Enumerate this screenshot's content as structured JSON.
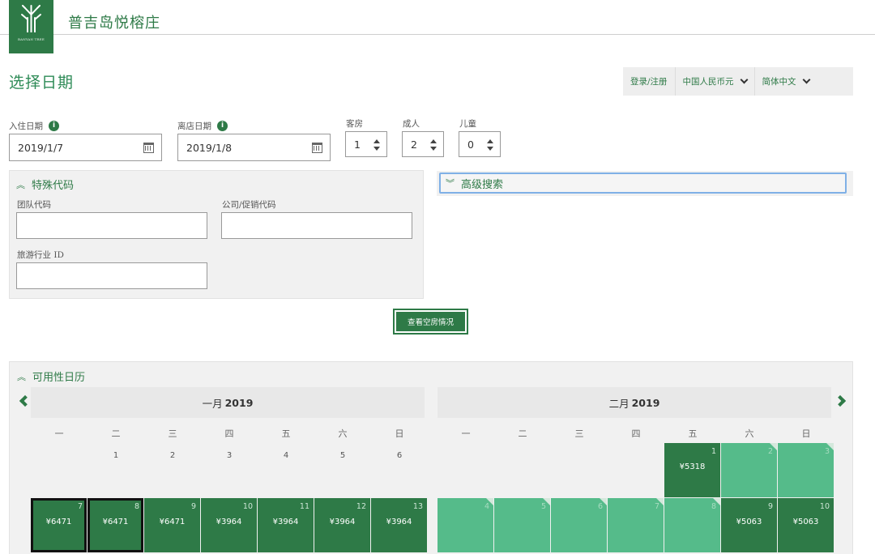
{
  "header": {
    "logo_text": "BANYAN TREE",
    "hotel_name": "普吉岛悦榕庄"
  },
  "page_title": "选择日期",
  "top_controls": {
    "login": "登录/注册",
    "currency": "中国人民币元",
    "language": "简体中文"
  },
  "search": {
    "checkin_label": "入住日期",
    "checkin_value": "2019/1/7",
    "checkout_label": "离店日期",
    "checkout_value": "2019/1/8",
    "rooms_label": "客房",
    "rooms_value": "1",
    "adults_label": "成人",
    "adults_value": "2",
    "children_label": "儿童",
    "children_value": "0"
  },
  "special_codes": {
    "title": "特殊代码",
    "group_label": "团队代码",
    "group_value": "",
    "corp_label": "公司/促销代码",
    "corp_value": "",
    "travel_label": "旅游行业 ID",
    "travel_value": ""
  },
  "advanced_search": {
    "title": "高级搜索"
  },
  "check_button": "查看空房情况",
  "availability": {
    "title": "可用性日历",
    "weekdays": [
      "一",
      "二",
      "三",
      "四",
      "五",
      "六",
      "日"
    ],
    "months": [
      {
        "name": "一月",
        "year": "2019",
        "week1": [
          "",
          "1",
          "2",
          "3",
          "4",
          "5",
          "6"
        ],
        "week2": [
          {
            "day": "7",
            "price": "¥6471",
            "selected": true
          },
          {
            "day": "8",
            "price": "¥6471",
            "selected": true
          },
          {
            "day": "9",
            "price": "¥6471"
          },
          {
            "day": "10",
            "price": "¥3964"
          },
          {
            "day": "11",
            "price": "¥3964"
          },
          {
            "day": "12",
            "price": "¥3964"
          },
          {
            "day": "13",
            "price": "¥3964"
          }
        ]
      },
      {
        "name": "二月",
        "year": "2019",
        "week1": [
          {
            "day": "",
            "price": ""
          },
          {
            "day": "",
            "price": ""
          },
          {
            "day": "",
            "price": ""
          },
          {
            "day": "",
            "price": ""
          },
          {
            "day": "1",
            "price": "¥5318"
          },
          {
            "day": "2",
            "price": ""
          },
          {
            "day": "3",
            "price": ""
          }
        ],
        "week2": [
          {
            "day": "4",
            "price": ""
          },
          {
            "day": "5",
            "price": ""
          },
          {
            "day": "6",
            "price": ""
          },
          {
            "day": "7",
            "price": ""
          },
          {
            "day": "8",
            "price": ""
          },
          {
            "day": "9",
            "price": "¥5063"
          },
          {
            "day": "10",
            "price": "¥5063"
          }
        ]
      }
    ]
  },
  "colors": {
    "brand_green": "#2e7a47",
    "available_dark": "#2e7a47",
    "available_light": "#55bb8a",
    "panel_bg": "#f1f1f1"
  }
}
